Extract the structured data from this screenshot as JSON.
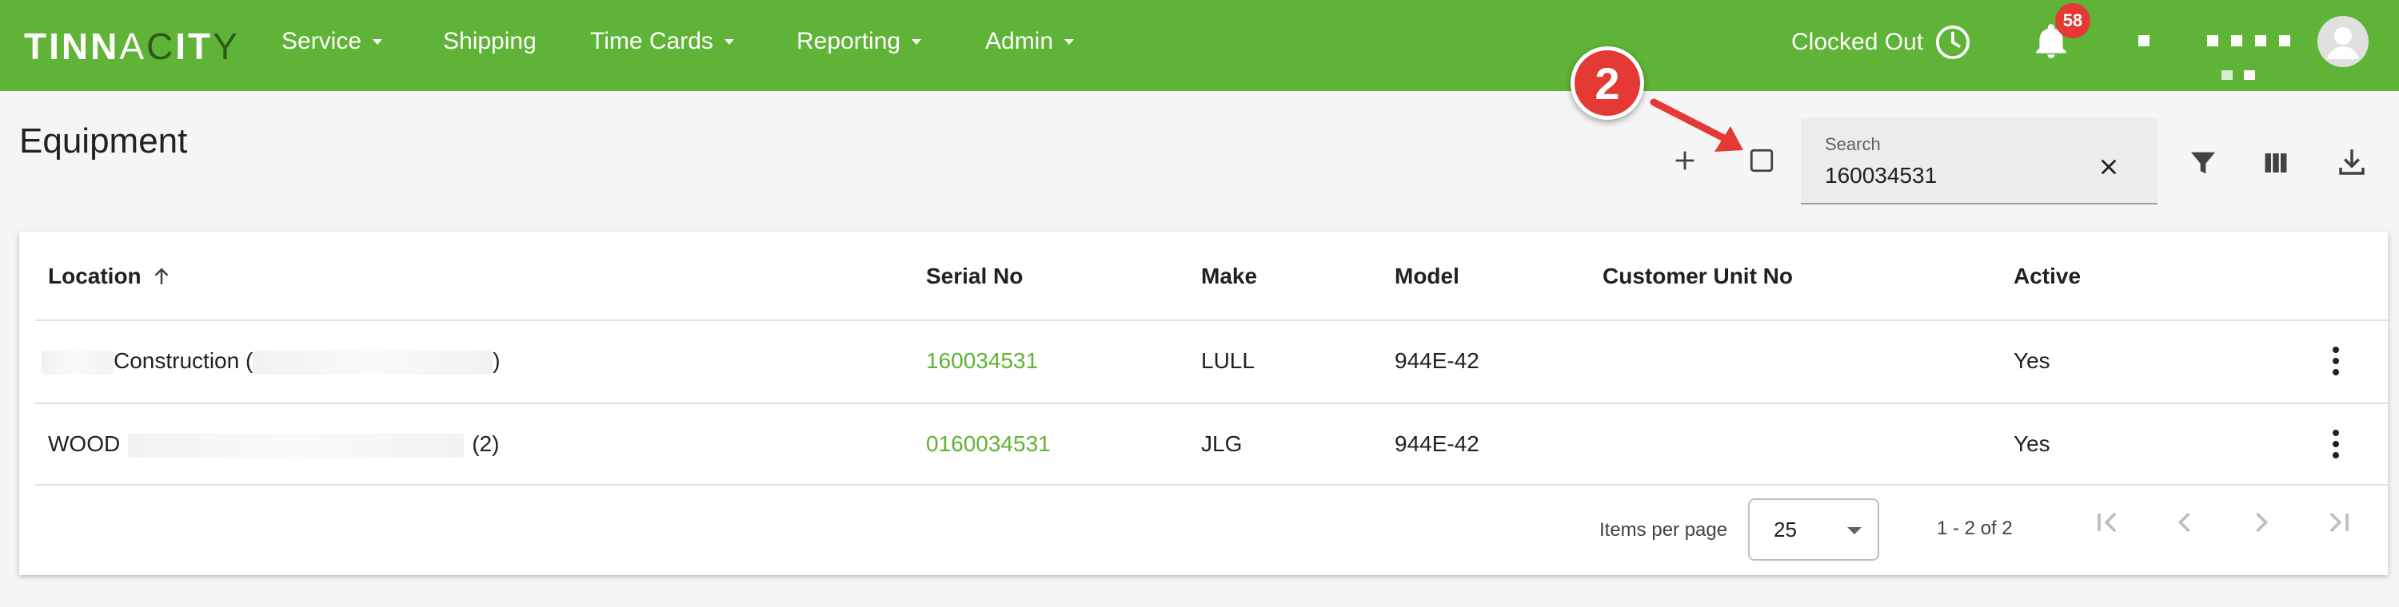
{
  "app": {
    "logo": {
      "p1": "T",
      "p2": "I",
      "p3": "NN",
      "p4": "A",
      "p5": "C",
      "p6": "I",
      "p7": "T",
      "p8": "Y"
    },
    "nav": [
      {
        "label": "Service",
        "has_caret": true
      },
      {
        "label": "Shipping",
        "has_caret": false
      },
      {
        "label": "Time Cards",
        "has_caret": true
      },
      {
        "label": "Reporting",
        "has_caret": true
      },
      {
        "label": "Admin",
        "has_caret": true
      }
    ],
    "clock_status": "Clocked Out",
    "notification_count": "58",
    "brand_color": "#5fb336"
  },
  "page": {
    "title": "Equipment",
    "callout_number": "2",
    "search": {
      "label": "Search",
      "value": "160034531"
    }
  },
  "table": {
    "columns": [
      "Location",
      "Serial No",
      "Make",
      "Model",
      "Customer Unit No",
      "Active"
    ],
    "sort_column": "Location",
    "sort_direction": "ascending",
    "rows": [
      {
        "location_prefix": "",
        "location_text": "Construction (",
        "location_suffix": ")",
        "serial": "160034531",
        "make": "LULL",
        "model": "944E-42",
        "customer_unit": "",
        "active": "Yes"
      },
      {
        "location_prefix": "",
        "location_text": "WOOD",
        "location_suffix": "(2)",
        "serial": "0160034531",
        "make": "JLG",
        "model": "944E-42",
        "customer_unit": "",
        "active": "Yes"
      }
    ]
  },
  "paginator": {
    "items_per_page_label": "Items per page",
    "items_per_page": "25",
    "range": "1 - 2 of 2"
  },
  "icons": {
    "add": "plus-icon",
    "select": "checkbox-icon",
    "filter": "filter-icon",
    "columns": "columns-icon",
    "download": "download-icon",
    "clear": "close-icon",
    "kebab": "more-vert-icon"
  }
}
